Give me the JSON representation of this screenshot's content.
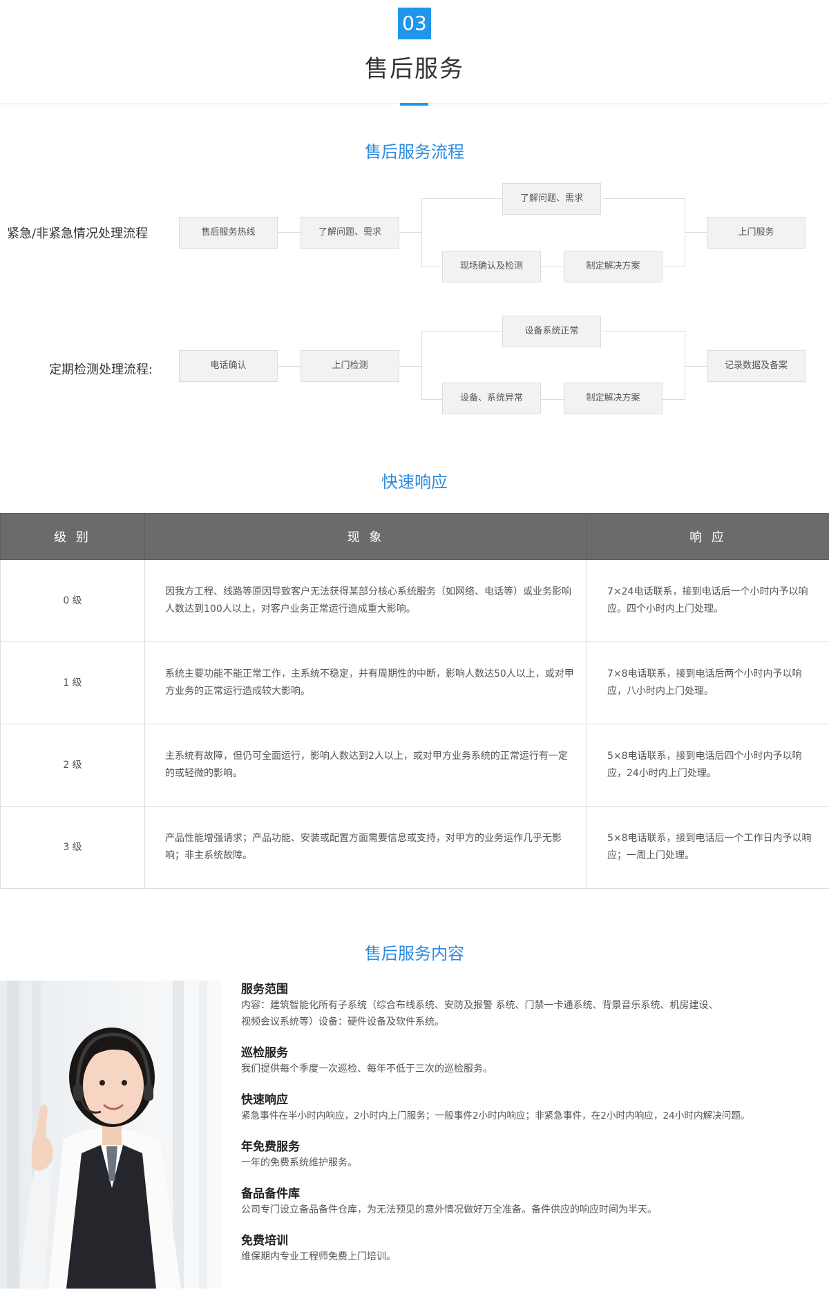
{
  "header": {
    "number": "03",
    "title": "售后服务"
  },
  "process": {
    "title": "售后服务流程",
    "flow1": {
      "label": "紧急/非紧急情况处理流程",
      "step1": "售后服务热线",
      "step2": "了解问题、需求",
      "branch_top": "了解问题、需求",
      "branch_bottom_a": "现场确认及检测",
      "branch_bottom_b": "制定解决方案",
      "end": "上门服务"
    },
    "flow2": {
      "label": "定期检测处理流程:",
      "step1": "电话确认",
      "step2": "上门检测",
      "branch_top": "设备系统正常",
      "branch_bottom_a": "设备、系统异常",
      "branch_bottom_b": "制定解决方案",
      "end": "记录数据及备案"
    }
  },
  "quick": {
    "title": "快速响应",
    "headers": [
      "级 别",
      "现 象",
      "响 应"
    ],
    "rows": [
      {
        "level": "0 级",
        "phenomenon": "因我方工程、线路等原因导致客户无法获得某部分核心系统服务（如网络、电话等）或业务影响人数达到100人以上，对客户业务正常运行造成重大影响。",
        "response": "7×24电话联系，接到电话后一个小时内予以响应。四个小时内上门处理。"
      },
      {
        "level": "1 级",
        "phenomenon": "系统主要功能不能正常工作，主系统不稳定，并有周期性的中断，影响人数达50人以上，或对甲方业务的正常运行造成较大影响。",
        "response": "7×8电话联系，接到电话后两个小时内予以响应，八小时内上门处理。"
      },
      {
        "level": "2 级",
        "phenomenon": "主系统有故障，但仍可全面运行，影响人数达到2人以上，或对甲方业务系统的正常运行有一定的或轻微的影响。",
        "response": "5×8电话联系，接到电话后四个小时内予以响应，24小时内上门处理。"
      },
      {
        "level": "3 级",
        "phenomenon": "产品性能增强请求；产品功能、安装或配置方面需要信息或支持，对甲方的业务运作几乎无影响；非主系统故障。",
        "response": "5×8电话联系，接到电话后一个工作日内予以响应；一周上门处理。"
      }
    ]
  },
  "content": {
    "title": "售后服务内容",
    "items": [
      {
        "title": "服务范围",
        "text": "内容：建筑智能化所有子系统（综合布线系统、安防及报警 系统、门禁一卡通系统、背景音乐系统、机房建设、\n视频会议系统等）设备：硬件设备及软件系统。"
      },
      {
        "title": "巡检服务",
        "text": "我们提供每个季度一次巡检、每年不低于三次的巡检服务。"
      },
      {
        "title": "快速响应",
        "text": "紧急事件在半小时内响应，2小时内上门服务；一般事件2小时内响应；非紧急事件，在2小时内响应，24小时内解决问题。"
      },
      {
        "title": "年免费服务",
        "text": "一年的免费系统维护服务。"
      },
      {
        "title": "备品备件库",
        "text": "公司专门设立备品备件仓库，为无法预见的意外情况做好万全准备。备件供应的响应时间为半天。"
      },
      {
        "title": "免费培训",
        "text": "维保期内专业工程师免费上门培训。"
      }
    ]
  },
  "colors": {
    "accent": "#2196e8",
    "heading_blue": "#2a8be0",
    "table_header": "#6b6b6b"
  }
}
